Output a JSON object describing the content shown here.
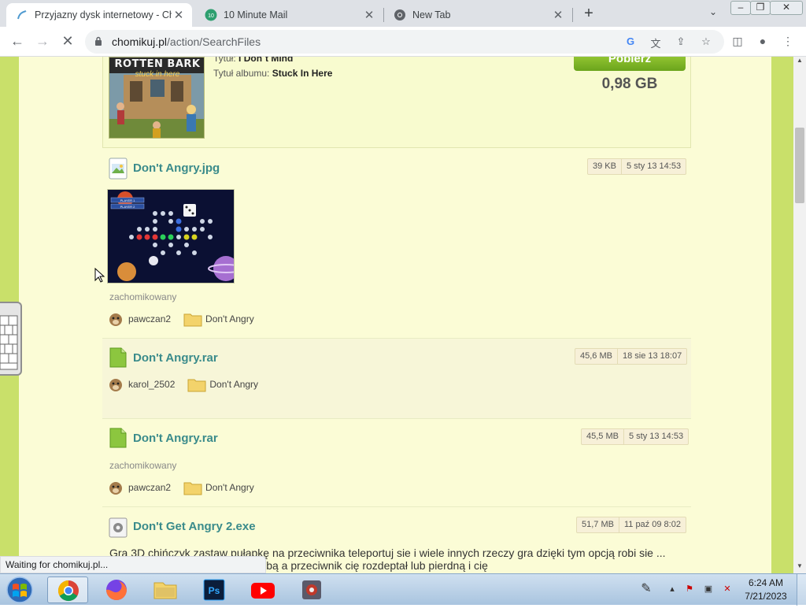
{
  "browser": {
    "tabs": [
      {
        "title": "Przyjazny dysk internetowy - Cho",
        "active": true
      },
      {
        "title": "10 Minute Mail",
        "active": false
      },
      {
        "title": "New Tab",
        "active": false
      }
    ],
    "url_domain": "chomikuj.pl",
    "url_path": "/action/SearchFiles",
    "status": "Waiting for chomikuj.pl..."
  },
  "top_card": {
    "album_art_text": "ROTTEN BARK",
    "album_art_sub": "stuck in here",
    "title_label": "Tytuł:",
    "title_value": "I Don´t Mind",
    "album_label": "Tytuł albumu:",
    "album_value": "Stuck In Here",
    "download_label": "Pobierz",
    "size": "0,98 GB"
  },
  "files": [
    {
      "name": "Don't Angry.jpg",
      "size": "39 KB",
      "date": "5 sty 13 14:53",
      "status": "zachomikowany",
      "owner": "pawczan2",
      "folder": "Don't Angry"
    },
    {
      "name": "Don't Angry.rar",
      "size": "45,6 MB",
      "date": "18 sie 13 18:07",
      "owner": "karol_2502",
      "folder": "Don't Angry"
    },
    {
      "name": "Don't Angry.rar",
      "size": "45,5 MB",
      "date": "5 sty 13 14:53",
      "status": "zachomikowany",
      "owner": "pawczan2",
      "folder": "Don't Angry"
    },
    {
      "name": "Don't Get Angry 2.exe",
      "size": "51,7 MB",
      "date": "11 paź 09 8:02",
      "description": "Gra 3D chińczyk zastaw pułapkę na przeciwnika teleportuj sie i wiele innych rzeczy gra dzięki tym opcją robi sie ... jąca jak już masz metę przed sobą a przeciwnik cię rozdeptał lub pierdną i cię"
    }
  ],
  "thumbnail_labels": [
    "PLAYER 1",
    "PLAYER 2"
  ],
  "taskbar": {
    "time": "6:24 AM",
    "date": "7/21/2023"
  },
  "colors": {
    "page_bg": "#c9e06a",
    "content_bg": "#fbfcd6",
    "link": "#3a8b8b",
    "download_btn": "#7cb526"
  }
}
